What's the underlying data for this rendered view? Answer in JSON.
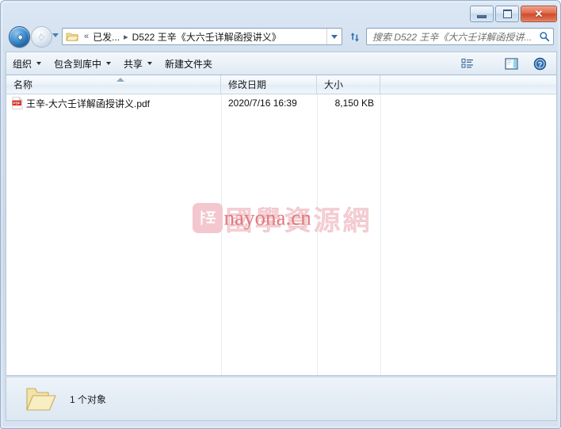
{
  "window": {
    "caption_buttons": {
      "minimize_label": "–",
      "maximize_label": "□",
      "close_label": "✕"
    }
  },
  "navigation": {
    "back_icon": "back-arrow-icon",
    "forward_icon": "forward-arrow-icon",
    "recent_pages_icon": "chevron-down-icon",
    "address": {
      "folder_icon": "folder-icon",
      "overflow_label": "«",
      "crumbs": [
        {
          "label": "已发..."
        },
        {
          "label": "D522 王辛《大六壬详解函授讲义》"
        }
      ],
      "separator": "▸",
      "dropdown_icon": "chevron-down-icon"
    },
    "refresh_icon": "refresh-icon",
    "search": {
      "placeholder": "搜索 D522 王辛《大六壬详解函授讲...",
      "icon": "search-icon"
    }
  },
  "toolbar": {
    "items": [
      {
        "label": "组织",
        "has_dropdown": true
      },
      {
        "label": "包含到库中",
        "has_dropdown": true
      },
      {
        "label": "共享",
        "has_dropdown": true
      },
      {
        "label": "新建文件夹",
        "has_dropdown": false
      }
    ],
    "view_icon": "view-options-icon",
    "view_dropdown_icon": "chevron-down-icon",
    "preview_pane_icon": "preview-pane-icon",
    "help_icon": "help-icon"
  },
  "file_list": {
    "columns": [
      {
        "key": "name",
        "label": "名称",
        "sorted": "asc"
      },
      {
        "key": "date",
        "label": "修改日期",
        "sorted": ""
      },
      {
        "key": "size",
        "label": "大小",
        "sorted": ""
      }
    ],
    "rows": [
      {
        "icon": "pdf-file-icon",
        "name": "王辛-大六壬详解函授讲义.pdf",
        "date": "2020/7/16 16:39",
        "size": "8,150 KB"
      }
    ]
  },
  "watermark": {
    "logo_icon": "nayona-logo-icon",
    "cjk_text": "國學資源網",
    "latin_text": "nayona.cn",
    "cjk_color": "#f6d6d9",
    "latin_color": "#e07b80",
    "logo_color": "#f3c7cd"
  },
  "status_bar": {
    "folder_icon": "open-folder-icon",
    "text": "1 个对象"
  },
  "colors": {
    "frame": "#cfdcec",
    "accent": "#3a6ea5",
    "close_button": "#cf4a28",
    "pdf_red": "#d7251d",
    "folder_yellow": "#f5dd92"
  }
}
